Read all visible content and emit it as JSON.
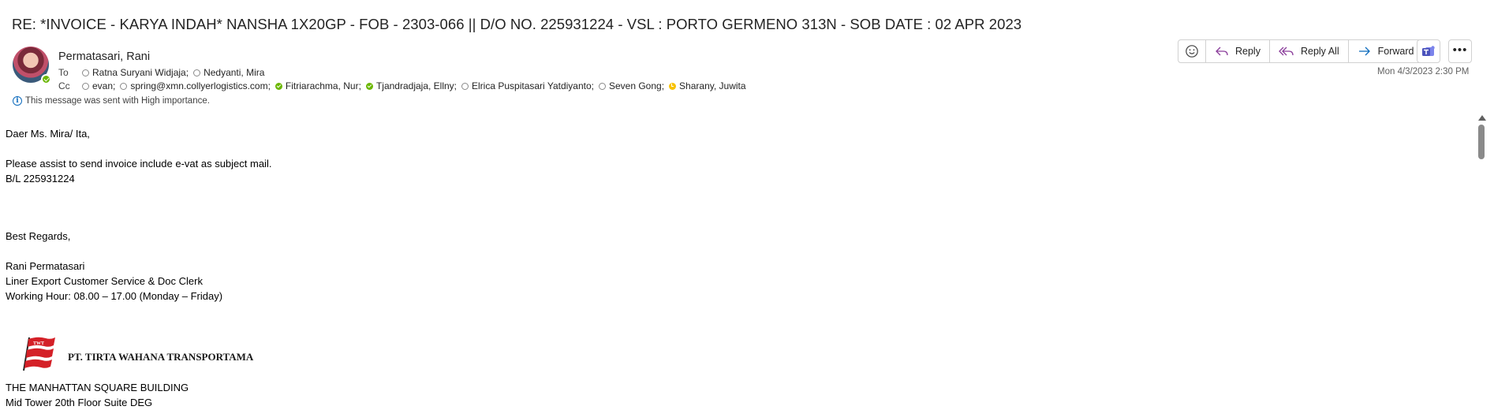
{
  "subject": "RE: *INVOICE - KARYA INDAH* NANSHA 1X20GP - FOB - 2303-066 || D/O NO. 225931224 - VSL : PORTO GERMENO 313N - SOB DATE : 02 APR 2023",
  "sender": "Permatasari, Rani",
  "to_label": "To",
  "cc_label": "Cc",
  "to": [
    {
      "name": "Ratna Suryani Widjaja;",
      "status": "offline"
    },
    {
      "name": "Nedyanti, Mira",
      "status": "offline"
    }
  ],
  "cc": [
    {
      "name": "evan;",
      "status": "offline"
    },
    {
      "name": "spring@xmn.collyerlogistics.com;",
      "status": "offline"
    },
    {
      "name": "Fitriarachma, Nur;",
      "status": "available"
    },
    {
      "name": "Tjandradjaja, Ellny;",
      "status": "available"
    },
    {
      "name": "Elrica Puspitasari Yatdiyanto;",
      "status": "offline"
    },
    {
      "name": "Seven Gong;",
      "status": "offline"
    },
    {
      "name": "Sharany, Juwita",
      "status": "away"
    }
  ],
  "importance_text": "This message was sent with High importance.",
  "actions": {
    "reply": "Reply",
    "reply_all": "Reply All",
    "forward": "Forward"
  },
  "date": "Mon 4/3/2023 2:30 PM",
  "body": {
    "greeting": "Daer Ms. Mira/ Ita,",
    "line1": "Please assist to send invoice include e-vat as subject mail.",
    "line2": "B/L 225931224",
    "regards": "Best Regards,",
    "sig_name": "Rani Permatasari",
    "sig_title": "Liner Export Customer Service & Doc Clerk",
    "sig_hours": "Working Hour: 08.00 – 17.00 (Monday – Friday)",
    "company": "PT.  TIRTA WAHANA TRANSPORTAMA",
    "logo_mark": "TWT",
    "addr1": "THE MANHATTAN SQUARE BUILDING",
    "addr2": "Mid Tower 20th Floor Suite DEG"
  },
  "colors": {
    "accent": "#0f6cbd",
    "reply_icon": "#8a3c9a",
    "available": "#6bb700",
    "away": "#f8c200",
    "teams": "#5b5fc7",
    "logo_red": "#d42027"
  }
}
